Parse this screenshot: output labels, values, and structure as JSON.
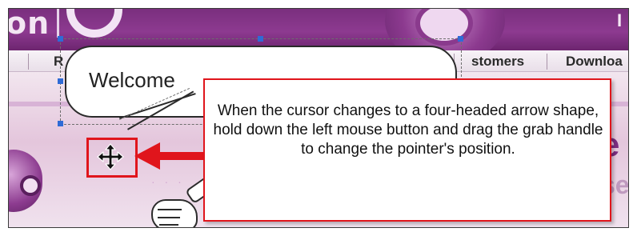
{
  "header": {
    "logo_text": "on",
    "corner_text": "I"
  },
  "nav": {
    "items": [
      "R",
      "stomers",
      "Downloa"
    ]
  },
  "bubble": {
    "text": "Welcome"
  },
  "callout": {
    "text": "When the cursor changes to a four-headed arrow shape, hold down the left mouse button and drag the grab handle to change the pointer's position."
  },
  "content": {
    "big_letter": "e",
    "partial_word": "se"
  },
  "icons": {
    "cursor": "four-headed-move-icon",
    "arrow": "left-arrow-icon"
  },
  "colors": {
    "accent_red": "#e0151c",
    "brand_purple": "#7a2f7e",
    "handle_blue": "#2f6bd6"
  }
}
